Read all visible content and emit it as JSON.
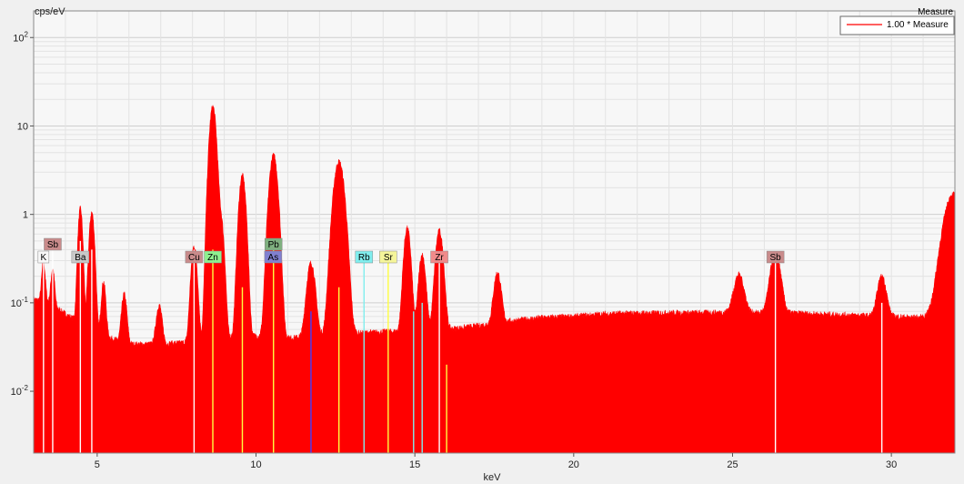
{
  "chart_data": {
    "type": "area",
    "title": "",
    "ylabel": "cps/eV",
    "xlabel": "keV",
    "yscale": "log",
    "xlim": [
      3,
      32
    ],
    "ylim": [
      0.002,
      200
    ],
    "grid": true,
    "legend_placement": "top-right",
    "colors": {
      "spectrum": "#ff0000",
      "plot_bg": "#f7f7f7",
      "grid": "#dcdcdc"
    },
    "x_ticks": [
      {
        "value": 5,
        "label": "5"
      },
      {
        "value": 10,
        "label": "10"
      },
      {
        "value": 15,
        "label": "15"
      },
      {
        "value": 20,
        "label": "20"
      },
      {
        "value": 25,
        "label": "25"
      },
      {
        "value": 30,
        "label": "30"
      }
    ],
    "y_ticks": [
      {
        "value": 0.01,
        "base": "10",
        "exp": "-2"
      },
      {
        "value": 0.1,
        "base": "10",
        "exp": "-1"
      },
      {
        "value": 1,
        "base": "1",
        "exp": ""
      },
      {
        "value": 10,
        "base": "10",
        "exp": ""
      },
      {
        "value": 100,
        "base": "10",
        "exp": "2"
      }
    ],
    "series": [
      {
        "name": "1.00 * Measure",
        "color": "#ff0000",
        "background": [
          [
            3.0,
            0.11
          ],
          [
            3.5,
            0.1
          ],
          [
            4.0,
            0.075
          ],
          [
            5.0,
            0.045
          ],
          [
            6.0,
            0.034
          ],
          [
            7.0,
            0.034
          ],
          [
            8.0,
            0.036
          ],
          [
            9.0,
            0.04
          ],
          [
            10.0,
            0.042
          ],
          [
            11.0,
            0.04
          ],
          [
            12.0,
            0.042
          ],
          [
            13.0,
            0.045
          ],
          [
            14.0,
            0.047
          ],
          [
            15.0,
            0.048
          ],
          [
            16.0,
            0.05
          ],
          [
            17.0,
            0.055
          ],
          [
            18.0,
            0.062
          ],
          [
            19.0,
            0.068
          ],
          [
            20.0,
            0.07
          ],
          [
            21.0,
            0.075
          ],
          [
            22.0,
            0.076
          ],
          [
            23.0,
            0.077
          ],
          [
            24.0,
            0.077
          ],
          [
            25.0,
            0.078
          ],
          [
            26.0,
            0.077
          ],
          [
            27.0,
            0.076
          ],
          [
            28.0,
            0.074
          ],
          [
            29.0,
            0.072
          ],
          [
            30.0,
            0.07
          ],
          [
            31.0,
            0.068
          ],
          [
            31.5,
            0.075
          ],
          [
            32.0,
            0.1
          ]
        ],
        "peaks": [
          {
            "center": 3.31,
            "height": 0.18,
            "width": 0.05
          },
          {
            "center": 3.6,
            "height": 0.15,
            "width": 0.05
          },
          {
            "center": 4.47,
            "height": 1.1,
            "width": 0.06
          },
          {
            "center": 4.83,
            "height": 1.0,
            "width": 0.07
          },
          {
            "center": 5.2,
            "height": 0.13,
            "width": 0.06
          },
          {
            "center": 5.85,
            "height": 0.09,
            "width": 0.07
          },
          {
            "center": 6.95,
            "height": 0.06,
            "width": 0.08
          },
          {
            "center": 8.05,
            "height": 0.4,
            "width": 0.08
          },
          {
            "center": 8.64,
            "height": 16.5,
            "width": 0.09
          },
          {
            "center": 8.9,
            "height": 0.8,
            "width": 0.08
          },
          {
            "center": 9.57,
            "height": 2.7,
            "width": 0.09
          },
          {
            "center": 10.55,
            "height": 4.6,
            "width": 0.11
          },
          {
            "center": 11.73,
            "height": 0.24,
            "width": 0.11
          },
          {
            "center": 12.61,
            "height": 3.9,
            "width": 0.14
          },
          {
            "center": 14.76,
            "height": 0.65,
            "width": 0.09
          },
          {
            "center": 15.23,
            "height": 0.3,
            "width": 0.09
          },
          {
            "center": 15.77,
            "height": 0.6,
            "width": 0.1
          },
          {
            "center": 17.6,
            "height": 0.16,
            "width": 0.1
          },
          {
            "center": 25.2,
            "height": 0.13,
            "width": 0.14
          },
          {
            "center": 26.35,
            "height": 0.28,
            "width": 0.14
          },
          {
            "center": 29.7,
            "height": 0.13,
            "width": 0.12
          },
          {
            "center": 31.95,
            "height": 1.6,
            "width": 0.25
          }
        ]
      }
    ],
    "element_labels": [
      {
        "symbol": "Sb",
        "energy": 3.6,
        "row": 2,
        "color": "#c98b8b"
      },
      {
        "symbol": "K",
        "energy": 3.31,
        "row": 1,
        "color": "#f7f7f7"
      },
      {
        "symbol": "Ba",
        "energy": 4.47,
        "row": 1,
        "color": "#c8c8c8"
      },
      {
        "symbol": "Cu",
        "energy": 8.05,
        "row": 1,
        "color": "#c98b8b"
      },
      {
        "symbol": "Zn",
        "energy": 8.64,
        "row": 1,
        "color": "#8ff08f"
      },
      {
        "symbol": "Pb",
        "energy": 10.55,
        "row": 2,
        "color": "#7fb07f"
      },
      {
        "symbol": "As",
        "energy": 10.54,
        "row": 1,
        "color": "#8080d0"
      },
      {
        "symbol": "Rb",
        "energy": 13.4,
        "row": 1,
        "color": "#80eeee"
      },
      {
        "symbol": "Sr",
        "energy": 14.16,
        "row": 1,
        "color": "#f5f59a"
      },
      {
        "symbol": "Zr",
        "energy": 15.77,
        "row": 1,
        "color": "#f08a8a"
      },
      {
        "symbol": "Sb",
        "energy": 26.35,
        "row": 1,
        "color": "#c98b8b"
      }
    ],
    "element_lines": [
      {
        "energy": 3.31,
        "height": 0.5,
        "color": "#ffffff"
      },
      {
        "energy": 3.6,
        "height": 0.5,
        "color": "#ffffff"
      },
      {
        "energy": 4.47,
        "height": 0.5,
        "color": "#ffffff"
      },
      {
        "energy": 4.83,
        "height": 0.4,
        "color": "#ffffff"
      },
      {
        "energy": 8.05,
        "height": 0.4,
        "color": "#ffffff"
      },
      {
        "energy": 8.64,
        "height": 0.4,
        "color": "#ffff40"
      },
      {
        "energy": 9.57,
        "height": 0.15,
        "color": "#ffff40"
      },
      {
        "energy": 10.55,
        "height": 0.4,
        "color": "#ffff40"
      },
      {
        "energy": 11.73,
        "height": 0.08,
        "color": "#4040ff"
      },
      {
        "energy": 12.61,
        "height": 0.15,
        "color": "#ffff40"
      },
      {
        "energy": 13.4,
        "height": 0.35,
        "color": "#80eeee"
      },
      {
        "energy": 14.16,
        "height": 0.35,
        "color": "#ffff40"
      },
      {
        "energy": 14.96,
        "height": 0.08,
        "color": "#80eeee"
      },
      {
        "energy": 15.23,
        "height": 0.1,
        "color": "#80eeee"
      },
      {
        "energy": 15.77,
        "height": 0.35,
        "color": "#ffffff"
      },
      {
        "energy": 16.0,
        "height": 0.02,
        "color": "#ffff40"
      },
      {
        "energy": 26.35,
        "height": 0.35,
        "color": "#ffffff"
      },
      {
        "energy": 29.7,
        "height": 0.1,
        "color": "#ffffff"
      }
    ]
  },
  "legend": {
    "title": "Measure",
    "entry_label": "1.00 * Measure"
  }
}
